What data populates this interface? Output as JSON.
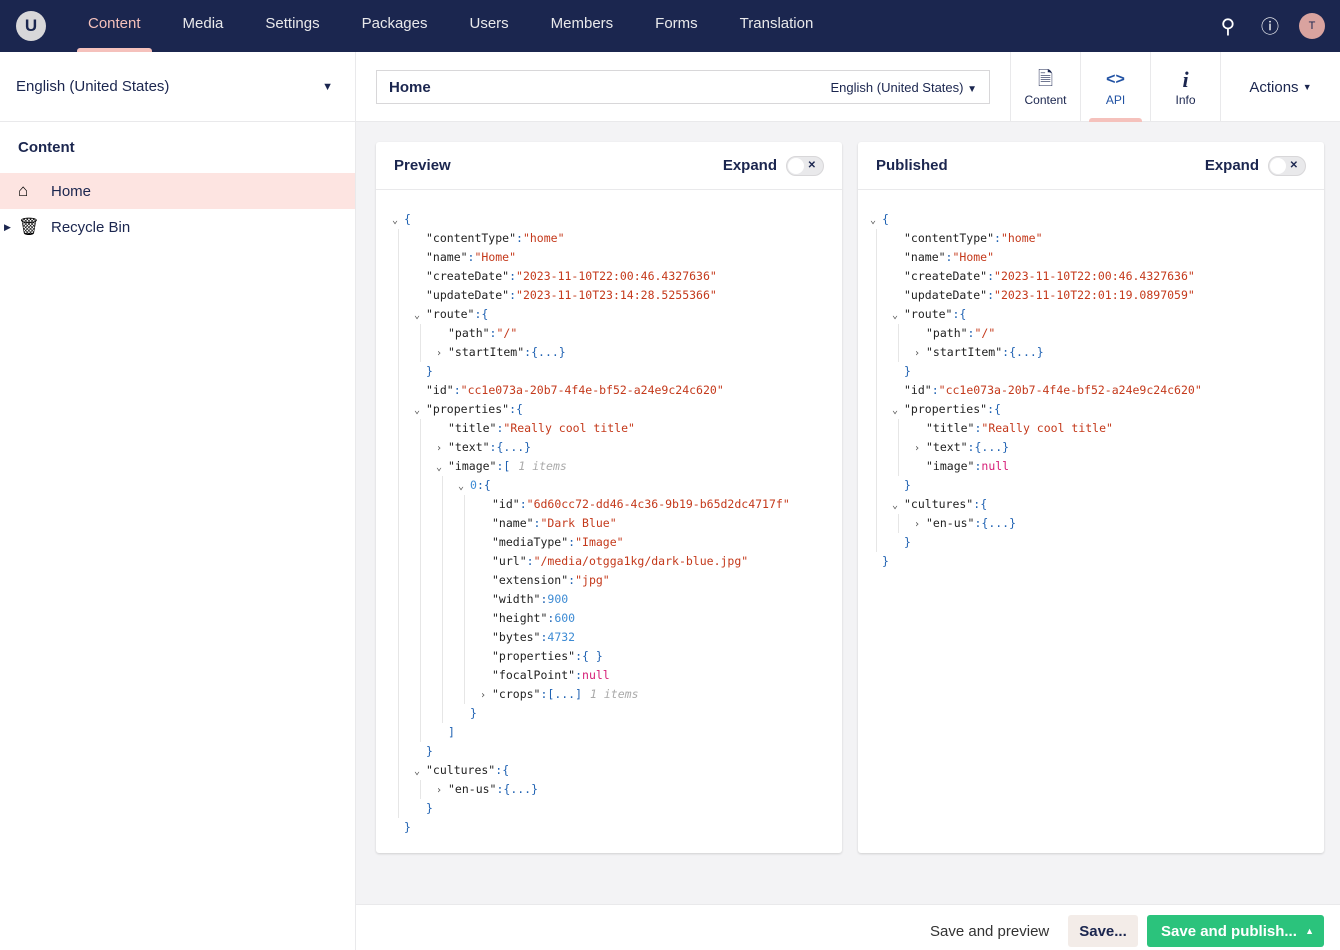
{
  "nav": {
    "logo": "U",
    "items": [
      "Content",
      "Media",
      "Settings",
      "Packages",
      "Users",
      "Members",
      "Forms",
      "Translation"
    ],
    "active": 0,
    "icons": [
      "search-icon",
      "help-icon"
    ],
    "avatar": "T"
  },
  "sidebar": {
    "language": "English (United States)",
    "tree_title": "Content",
    "items": [
      {
        "label": "Home",
        "icon": "home-icon",
        "active": true
      },
      {
        "label": "Recycle Bin",
        "icon": "trash-icon",
        "active": false
      }
    ]
  },
  "header": {
    "name": "Home",
    "culture": "English (United States)",
    "apps": [
      {
        "label": "Content",
        "icon": "document-icon"
      },
      {
        "label": "API",
        "icon": "code-icon",
        "active": true
      },
      {
        "label": "Info",
        "icon": "info-icon"
      }
    ],
    "actions": "Actions"
  },
  "preview": {
    "title": "Preview",
    "expand": "Expand",
    "expanded": false,
    "lines": [
      {
        "d": 0,
        "t": "o",
        "v": "{",
        "vt": "b"
      },
      {
        "d": 1,
        "k": "\"contentType\"",
        "v": "\"home\"",
        "vt": "s"
      },
      {
        "d": 1,
        "k": "\"name\"",
        "v": "\"Home\"",
        "vt": "s"
      },
      {
        "d": 1,
        "k": "\"createDate\"",
        "v": "\"2023-11-10T22:00:46.4327636\"",
        "vt": "s"
      },
      {
        "d": 1,
        "k": "\"updateDate\"",
        "v": "\"2023-11-10T23:14:28.5255366\"",
        "vt": "s"
      },
      {
        "d": 1,
        "t": "o",
        "k": "\"route\"",
        "v": "{",
        "vt": "b"
      },
      {
        "d": 2,
        "k": "\"path\"",
        "v": "\"/\"",
        "vt": "s"
      },
      {
        "d": 2,
        "t": "c",
        "k": "\"startItem\"",
        "v": "{...}",
        "vt": "b"
      },
      {
        "d": 1,
        "v": "}",
        "vt": "b"
      },
      {
        "d": 1,
        "k": "\"id\"",
        "v": "\"cc1e073a-20b7-4f4e-bf52-a24e9c24c620\"",
        "vt": "s"
      },
      {
        "d": 1,
        "t": "o",
        "k": "\"properties\"",
        "v": "{",
        "vt": "b"
      },
      {
        "d": 2,
        "k": "\"title\"",
        "v": "\"Really cool title\"",
        "vt": "s"
      },
      {
        "d": 2,
        "t": "c",
        "k": "\"text\"",
        "v": "{...}",
        "vt": "b"
      },
      {
        "d": 2,
        "t": "o",
        "k": "\"image\"",
        "v": "[",
        "vt": "b",
        "note": "1 items"
      },
      {
        "d": 3,
        "t": "o",
        "k": "0",
        "v": "{",
        "vt": "b",
        "kt": "n"
      },
      {
        "d": 4,
        "k": "\"id\"",
        "v": "\"6d60cc72-dd46-4c36-9b19-b65d2dc4717f\"",
        "vt": "s"
      },
      {
        "d": 4,
        "k": "\"name\"",
        "v": "\"Dark Blue\"",
        "vt": "s"
      },
      {
        "d": 4,
        "k": "\"mediaType\"",
        "v": "\"Image\"",
        "vt": "s"
      },
      {
        "d": 4,
        "k": "\"url\"",
        "v": "\"/media/otgga1kg/dark-blue.jpg\"",
        "vt": "s"
      },
      {
        "d": 4,
        "k": "\"extension\"",
        "v": "\"jpg\"",
        "vt": "s"
      },
      {
        "d": 4,
        "k": "\"width\"",
        "v": "900",
        "vt": "n"
      },
      {
        "d": 4,
        "k": "\"height\"",
        "v": "600",
        "vt": "n"
      },
      {
        "d": 4,
        "k": "\"bytes\"",
        "v": "4732",
        "vt": "n"
      },
      {
        "d": 4,
        "k": "\"properties\"",
        "v": "{ }",
        "vt": "b"
      },
      {
        "d": 4,
        "k": "\"focalPoint\"",
        "v": "null",
        "vt": "nu"
      },
      {
        "d": 4,
        "t": "c",
        "k": "\"crops\"",
        "v": "[...]",
        "vt": "b",
        "note": "1 items"
      },
      {
        "d": 3,
        "v": "}",
        "vt": "b"
      },
      {
        "d": 2,
        "v": "]",
        "vt": "b"
      },
      {
        "d": 1,
        "v": "}",
        "vt": "b"
      },
      {
        "d": 1,
        "t": "o",
        "k": "\"cultures\"",
        "v": "{",
        "vt": "b"
      },
      {
        "d": 2,
        "t": "c",
        "k": "\"en-us\"",
        "v": "{...}",
        "vt": "b"
      },
      {
        "d": 1,
        "v": "}",
        "vt": "b"
      },
      {
        "d": 0,
        "v": "}",
        "vt": "b"
      }
    ]
  },
  "published": {
    "title": "Published",
    "expand": "Expand",
    "expanded": false,
    "lines": [
      {
        "d": 0,
        "t": "o",
        "v": "{",
        "vt": "b"
      },
      {
        "d": 1,
        "k": "\"contentType\"",
        "v": "\"home\"",
        "vt": "s"
      },
      {
        "d": 1,
        "k": "\"name\"",
        "v": "\"Home\"",
        "vt": "s"
      },
      {
        "d": 1,
        "k": "\"createDate\"",
        "v": "\"2023-11-10T22:00:46.4327636\"",
        "vt": "s"
      },
      {
        "d": 1,
        "k": "\"updateDate\"",
        "v": "\"2023-11-10T22:01:19.0897059\"",
        "vt": "s"
      },
      {
        "d": 1,
        "t": "o",
        "k": "\"route\"",
        "v": "{",
        "vt": "b"
      },
      {
        "d": 2,
        "k": "\"path\"",
        "v": "\"/\"",
        "vt": "s"
      },
      {
        "d": 2,
        "t": "c",
        "k": "\"startItem\"",
        "v": "{...}",
        "vt": "b"
      },
      {
        "d": 1,
        "v": "}",
        "vt": "b"
      },
      {
        "d": 1,
        "k": "\"id\"",
        "v": "\"cc1e073a-20b7-4f4e-bf52-a24e9c24c620\"",
        "vt": "s"
      },
      {
        "d": 1,
        "t": "o",
        "k": "\"properties\"",
        "v": "{",
        "vt": "b"
      },
      {
        "d": 2,
        "k": "\"title\"",
        "v": "\"Really cool title\"",
        "vt": "s"
      },
      {
        "d": 2,
        "t": "c",
        "k": "\"text\"",
        "v": "{...}",
        "vt": "b"
      },
      {
        "d": 2,
        "k": "\"image\"",
        "v": "null",
        "vt": "nu"
      },
      {
        "d": 1,
        "v": "}",
        "vt": "b"
      },
      {
        "d": 1,
        "t": "o",
        "k": "\"cultures\"",
        "v": "{",
        "vt": "b"
      },
      {
        "d": 2,
        "t": "c",
        "k": "\"en-us\"",
        "v": "{...}",
        "vt": "b"
      },
      {
        "d": 1,
        "v": "}",
        "vt": "b"
      },
      {
        "d": 0,
        "v": "}",
        "vt": "b"
      }
    ]
  },
  "footer": {
    "save_preview": "Save and preview",
    "save": "Save...",
    "save_publish": "Save and publish..."
  },
  "colors": {
    "nav_bg": "#1b264f",
    "accent": "#f5c1bc",
    "publish": "#2bc37c"
  }
}
